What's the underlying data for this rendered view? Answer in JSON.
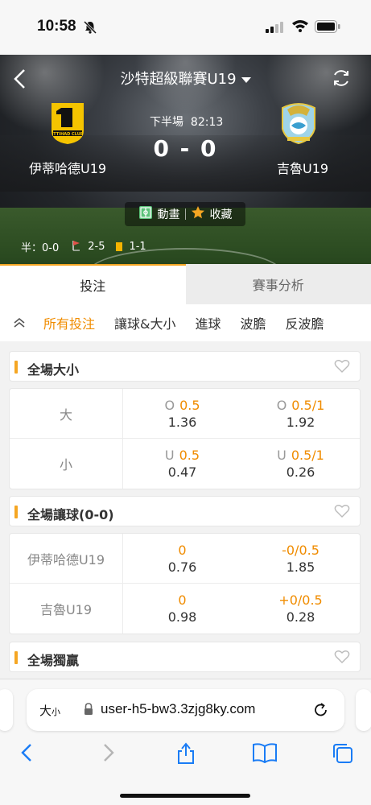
{
  "status": {
    "time": "10:58"
  },
  "header": {
    "title": "沙特超級聯賽U19",
    "home_team": "伊蒂哈德U19",
    "away_team": "吉魯U19",
    "period": "下半場",
    "clock": "82:13",
    "score": "0 - 0",
    "animation_label": "動畫",
    "favorite_label": "收藏",
    "half_score": "半：0-0",
    "corners": "2-5",
    "yellow_cards": "1-1",
    "home_logo_text": "ITTIHAD CLUB"
  },
  "tabs": [
    {
      "label": "投注",
      "active": true
    },
    {
      "label": "賽事分析",
      "active": false
    }
  ],
  "filters": [
    {
      "label": "所有投注",
      "active": true
    },
    {
      "label": "讓球&大小",
      "active": false
    },
    {
      "label": "進球",
      "active": false
    },
    {
      "label": "波膽",
      "active": false
    },
    {
      "label": "反波膽",
      "active": false
    }
  ],
  "sections": {
    "total": {
      "title": "全場大小",
      "rows": [
        {
          "name": "大",
          "a_pre": "O",
          "a_line": "0.5",
          "a_price": "1.36",
          "b_pre": "O",
          "b_line": "0.5/1",
          "b_price": "1.92"
        },
        {
          "name": "小",
          "a_pre": "U",
          "a_line": "0.5",
          "a_price": "0.47",
          "b_pre": "U",
          "b_line": "0.5/1",
          "b_price": "0.26"
        }
      ]
    },
    "handicap": {
      "title": "全場讓球(0-0)",
      "rows": [
        {
          "name": "伊蒂哈德U19",
          "a_line": "0",
          "a_price": "0.76",
          "b_line": "-0/0.5",
          "b_price": "1.85"
        },
        {
          "name": "吉魯U19",
          "a_line": "0",
          "a_price": "0.98",
          "b_line": "+0/0.5",
          "b_price": "0.28"
        }
      ]
    },
    "winner": {
      "title": "全場獨贏"
    }
  },
  "browser": {
    "aa_big": "大",
    "aa_small": "小",
    "url": "user-h5-bw3.3zjg8ky.com"
  },
  "colors": {
    "accent": "#f5a623",
    "odds_line": "#f08c00"
  }
}
